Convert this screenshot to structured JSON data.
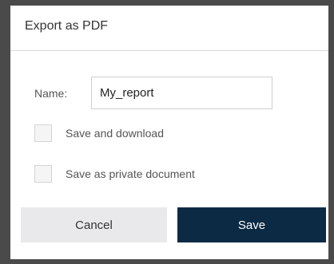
{
  "dialog": {
    "title": "Export as PDF"
  },
  "form": {
    "name_label": "Name:",
    "name_value": "My_report",
    "checkboxes": [
      {
        "label": "Save and download",
        "checked": false
      },
      {
        "label": "Save as private document",
        "checked": false
      }
    ]
  },
  "buttons": {
    "cancel_label": "Cancel",
    "save_label": "Save"
  },
  "colors": {
    "primary": "#0d2a45",
    "secondary": "#e9e9eb",
    "overlay": "#4a4a4a"
  }
}
